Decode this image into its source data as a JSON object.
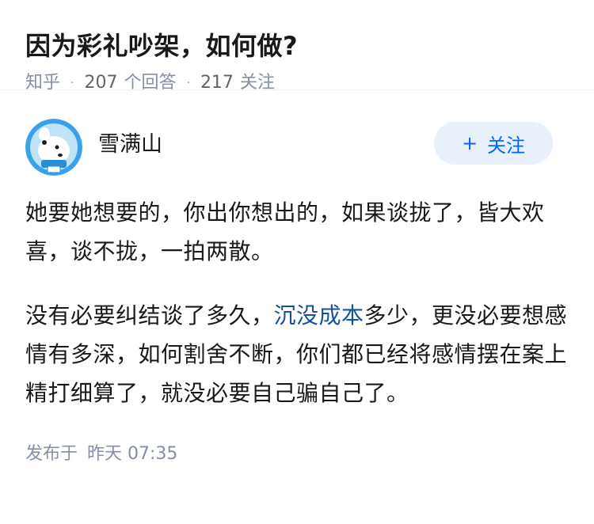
{
  "question": {
    "title": "因为彩礼吵架，如何做?",
    "site": "知乎",
    "answer_count": "207",
    "answer_label": "个回答",
    "follower_count": "217",
    "follower_label": "关注",
    "separator": "·"
  },
  "author": {
    "name": "雪满山",
    "follow_label": "关注",
    "follow_icon": "+"
  },
  "content": {
    "para1": "她要她想要的，你出你想出的，如果谈拢了，皆大欢喜，谈不拢，一拍两散。",
    "para2_before": "没有必要纠结谈了多久，",
    "para2_link": "沉没成本",
    "para2_after": "多少，更没必要想感情有多深，如何割舍不断，你们都已经将感情摆在案上精打细算了，就没必要自己骗自己了。"
  },
  "footer": {
    "published_label": "发布于",
    "published_time": "昨天 07:35"
  },
  "colors": {
    "link": "#175199",
    "follow_text": "#0066ff",
    "follow_bg": "#e8f0fb",
    "meta": "#8590a6"
  }
}
